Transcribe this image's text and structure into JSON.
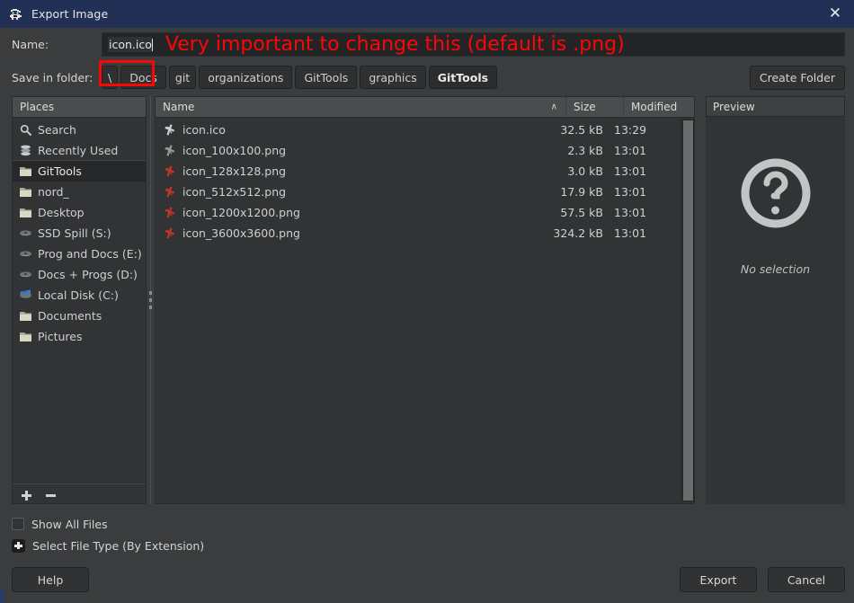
{
  "titlebar": {
    "title": "Export Image",
    "icon": "wilber-icon",
    "close_label": "✕"
  },
  "name_row": {
    "label": "Name:",
    "value": "icon.ico",
    "annotation": "Very important to change this (default is .png)",
    "annotation_color": "#fd0606",
    "highlight_box_color": "#fc0505"
  },
  "folder_row": {
    "label": "Save in folder:",
    "crumbs": [
      {
        "label": "\\",
        "active": false
      },
      {
        "label": "Docs",
        "active": false
      },
      {
        "label": "git",
        "active": false
      },
      {
        "label": "organizations",
        "active": false
      },
      {
        "label": "GitTools",
        "active": false
      },
      {
        "label": "graphics",
        "active": false
      },
      {
        "label": "GitTools",
        "active": true
      }
    ],
    "create_folder_label": "Create Folder"
  },
  "places": {
    "header": "Places",
    "items": [
      {
        "label": "Search",
        "icon": "search-icon",
        "selected": false
      },
      {
        "label": "Recently Used",
        "icon": "recent-icon",
        "selected": false
      },
      {
        "label": "GitTools",
        "icon": "folder-icon",
        "selected": true
      },
      {
        "label": "nord_",
        "icon": "folder-icon",
        "selected": false
      },
      {
        "label": "Desktop",
        "icon": "folder-icon",
        "selected": false
      },
      {
        "label": "SSD Spill (S:)",
        "icon": "drive-icon",
        "selected": false
      },
      {
        "label": "Prog and Docs (E:)",
        "icon": "drive-icon",
        "selected": false
      },
      {
        "label": "Docs + Progs (D:)",
        "icon": "drive-icon",
        "selected": false
      },
      {
        "label": "Local Disk (C:)",
        "icon": "system-drive-icon",
        "selected": false
      },
      {
        "label": "Documents",
        "icon": "folder-icon",
        "selected": false
      },
      {
        "label": "Pictures",
        "icon": "folder-icon",
        "selected": false
      }
    ],
    "add_button": "add-place-button",
    "remove_button": "remove-place-button"
  },
  "filelist": {
    "columns": {
      "name": "Name",
      "size": "Size",
      "modified": "Modified"
    },
    "sort_arrow": "∧",
    "rows": [
      {
        "name": "icon.ico",
        "size": "32.5 kB",
        "modified": "13:29",
        "icon": "ico-file-icon"
      },
      {
        "name": "icon_100x100.png",
        "size": "2.3 kB",
        "modified": "13:01",
        "icon": "png-file-icon-small"
      },
      {
        "name": "icon_128x128.png",
        "size": "3.0 kB",
        "modified": "13:01",
        "icon": "png-file-icon"
      },
      {
        "name": "icon_512x512.png",
        "size": "17.9 kB",
        "modified": "13:01",
        "icon": "png-file-icon"
      },
      {
        "name": "icon_1200x1200.png",
        "size": "57.5 kB",
        "modified": "13:01",
        "icon": "png-file-icon"
      },
      {
        "name": "icon_3600x3600.png",
        "size": "324.2 kB",
        "modified": "13:01",
        "icon": "png-file-icon"
      }
    ]
  },
  "preview": {
    "header": "Preview",
    "icon": "question-mark-icon",
    "status": "No selection"
  },
  "options": {
    "show_all_files": "Show All Files",
    "select_file_type": "Select File Type (By Extension)",
    "show_all_files_checked": false,
    "select_file_type_expanded": false
  },
  "footer": {
    "help": "Help",
    "export": "Export",
    "cancel": "Cancel"
  }
}
